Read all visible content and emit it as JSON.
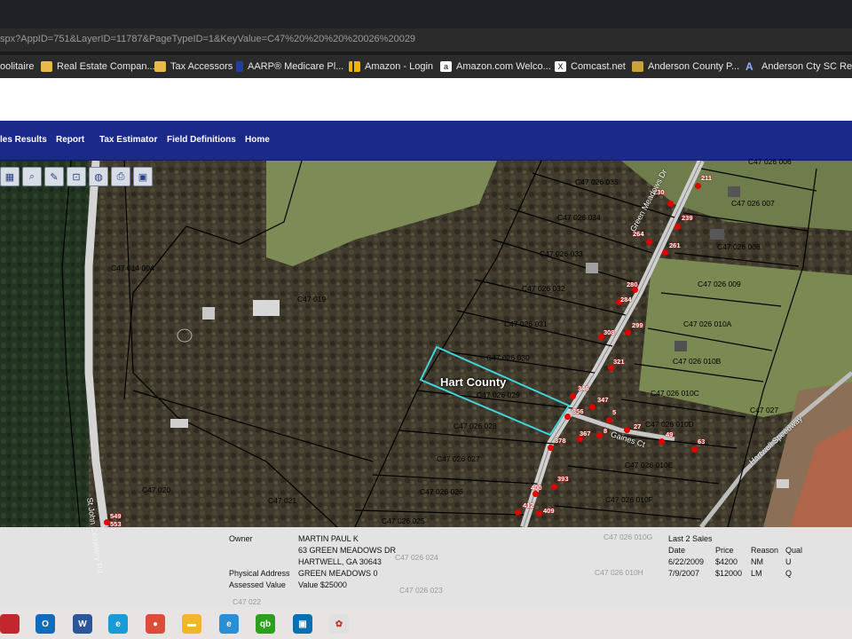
{
  "browser": {
    "url": "spx?AppID=751&LayerID=11787&PageTypeID=1&KeyValue=C47%20%20%20%20026%20029",
    "bookmarks": [
      {
        "label": "oolitaire",
        "icon": "solitaire-icon",
        "color": "#4caf50"
      },
      {
        "label": "Real Estate Compan...",
        "icon": "folder-icon",
        "color": "#e8b84a"
      },
      {
        "label": "Tax Accessors",
        "icon": "folder-icon",
        "color": "#e8b84a"
      },
      {
        "label": "AARP® Medicare Pl...",
        "icon": "shield-icon",
        "color": "#1e3f9a"
      },
      {
        "label": "Amazon - Login",
        "icon": "bars-icon",
        "color": "#f0b400"
      },
      {
        "label": "Amazon.com Welco...",
        "icon": "amazon-icon",
        "color": "#ffffff"
      },
      {
        "label": "Comcast.net",
        "icon": "x-icon",
        "color": "#ffffff"
      },
      {
        "label": "Anderson County P...",
        "icon": "county-icon",
        "color": "#c8a23a"
      },
      {
        "label": "Anderson Cty SC Re...",
        "icon": "a-icon",
        "color": "#4a6fd0"
      }
    ]
  },
  "nav": {
    "items": [
      "les Results",
      "Report",
      "Tax Estimator",
      "Field Definitions",
      "Home"
    ]
  },
  "map": {
    "county_label": "Hart County",
    "road_labels": [
      "Green Meadows Dr",
      "Gaines Ct",
      "Hartwell Speedway",
      "St John Cemetery Rd"
    ],
    "parcels": [
      "C47 026 006",
      "C47 026 035",
      "C47 026 007",
      "C47 026 034",
      "C47 026 008",
      "C47 014 004",
      "C47 026 033",
      "C47 026 009",
      "C47 019",
      "C47 026 032",
      "C47 026 031",
      "C47 026 010A",
      "C47 026 030",
      "C47 026 010B",
      "C47 026 029",
      "C47 026 010C",
      "C47 027",
      "C47 026 028",
      "C47 026 010D",
      "C47 026 027",
      "C47 026 010E",
      "C47 020",
      "C47 026 026",
      "C47 026 010F",
      "C47 021",
      "C47 026 025"
    ],
    "addresses": [
      "211",
      "230",
      "239",
      "264",
      "261",
      "280",
      "284",
      "299",
      "308",
      "321",
      "346",
      "347",
      "356",
      "5",
      "27",
      "367",
      "8",
      "49",
      "63",
      "378",
      "393",
      "400",
      "412",
      "409",
      "549",
      "553"
    ]
  },
  "info": {
    "owner_label": "Owner",
    "owner_name": "MARTIN PAUL K",
    "owner_addr1": "63 GREEN MEADOWS DR",
    "owner_addr2": "HARTWELL, GA 30643",
    "physical_label": "Physical Address",
    "physical_value": "GREEN MEADOWS 0",
    "assessed_label": "Assessed Value",
    "assessed_value": "Value $25000",
    "sales_title": "Last 2 Sales",
    "sales_headers": [
      "Date",
      "Price",
      "Reason",
      "Qual"
    ],
    "sales": [
      [
        "6/22/2009",
        "$4200",
        "NM",
        "U"
      ],
      [
        "7/9/2007",
        "$12000",
        "LM",
        "Q"
      ]
    ],
    "ghost_labels": [
      "C47 026 024",
      "C47 026 023",
      "C47 026 010G",
      "C47 026 010H",
      "C47 022"
    ]
  },
  "taskbar": {
    "apps": [
      {
        "name": "pdf-app-icon",
        "color": "#c1272d",
        "glyph": ""
      },
      {
        "name": "outlook-icon",
        "color": "#0f6cbd",
        "glyph": "O"
      },
      {
        "name": "word-icon",
        "color": "#2b579a",
        "glyph": "W"
      },
      {
        "name": "edge-icon",
        "color": "#1a9bd7",
        "glyph": "e"
      },
      {
        "name": "chrome-icon",
        "color": "#dd4b39",
        "glyph": "●"
      },
      {
        "name": "file-explorer-icon",
        "color": "#f2b52c",
        "glyph": "▬"
      },
      {
        "name": "internet-explorer-icon",
        "color": "#2b8fd6",
        "glyph": "e"
      },
      {
        "name": "quickbooks-icon",
        "color": "#2ca01c",
        "glyph": "qb"
      },
      {
        "name": "remote-desktop-icon",
        "color": "#0a6fb0",
        "glyph": "▣"
      },
      {
        "name": "paint-icon",
        "color": "#e0e0e0",
        "glyph": "✿"
      }
    ]
  },
  "colors": {
    "nav_bg": "#1b2a8a",
    "selected_parcel": "#3fd6e0",
    "address_dot": "#e20000"
  }
}
